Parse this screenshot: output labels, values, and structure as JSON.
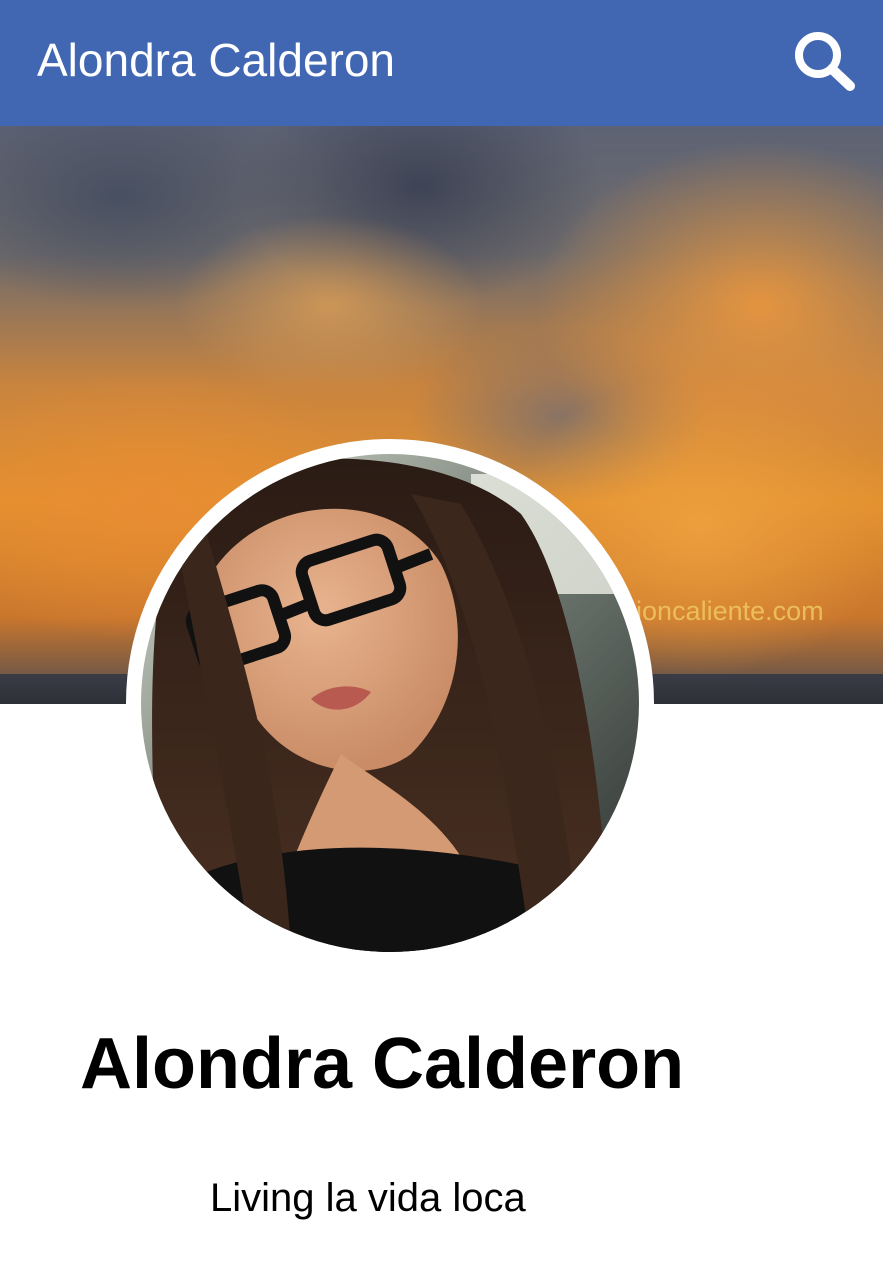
{
  "header": {
    "title": "Alondra Calderon",
    "search_icon": "search-icon",
    "bg_color": "#4267b2"
  },
  "cover": {
    "watermark": "legioncaliente.com"
  },
  "profile": {
    "name": "Alondra Calderon",
    "bio": "Living la vida loca",
    "avatar_icon": "profile-photo"
  }
}
